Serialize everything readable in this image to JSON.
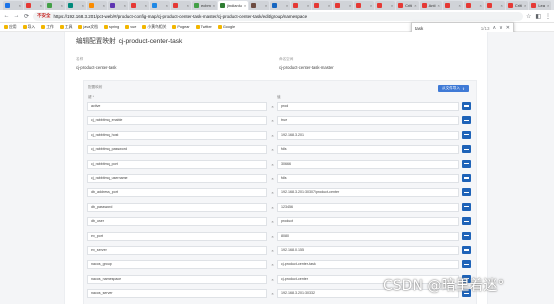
{
  "browser": {
    "tabs": [
      {
        "label": "",
        "color": "#1a73e8",
        "active": false
      },
      {
        "label": "",
        "color": "#e53935",
        "active": false
      },
      {
        "label": "",
        "color": "#43a047",
        "active": false
      },
      {
        "label": "",
        "color": "#00897b",
        "active": false
      },
      {
        "label": "",
        "color": "#fb8c00",
        "active": false
      },
      {
        "label": "",
        "color": "#5e35b1",
        "active": false
      },
      {
        "label": "",
        "color": "#e53935",
        "active": false
      },
      {
        "label": "",
        "color": "#1e88e5",
        "active": false
      },
      {
        "label": "",
        "color": "#e53935",
        "active": false
      },
      {
        "label": "ecbm",
        "color": "#43a047",
        "active": false
      },
      {
        "label": "jindianlu",
        "color": "#2e7d32",
        "active": true
      },
      {
        "label": "",
        "color": "#6d4c41",
        "active": false
      },
      {
        "label": "",
        "color": "#1565c0",
        "active": false
      },
      {
        "label": "",
        "color": "#e53935",
        "active": false
      },
      {
        "label": "",
        "color": "#e53935",
        "active": false
      },
      {
        "label": "",
        "color": "#e53935",
        "active": false
      },
      {
        "label": "",
        "color": "#e53935",
        "active": false
      },
      {
        "label": "",
        "color": "#e53935",
        "active": false
      },
      {
        "label": "Criti",
        "color": "#e53935",
        "active": false
      },
      {
        "label": "Anti",
        "color": "#e53935",
        "active": false
      },
      {
        "label": "",
        "color": "#e53935",
        "active": false
      },
      {
        "label": "",
        "color": "#e53935",
        "active": false
      },
      {
        "label": "",
        "color": "#e53935",
        "active": false
      },
      {
        "label": "Criti",
        "color": "#e53935",
        "active": false
      },
      {
        "label": "Lea",
        "color": "#e53935",
        "active": false
      }
    ],
    "url_prefix": "不安全",
    "url": "https://192.168.3.201/pct-web/#/product-config-map/cj-product-center-task-master/cj-product-center-task/edit/group/namespace",
    "bookmarks": [
      "应用",
      "导入",
      "工作",
      "工具",
      "java文档",
      "spring",
      "vue",
      "小黄鸟相关",
      "Pogear",
      "Twitter",
      "Google"
    ],
    "find": {
      "query": "task",
      "count": "1/13"
    }
  },
  "page": {
    "title_prefix": "编辑配置映射",
    "title": "cj-product-center-task",
    "meta": {
      "left_label": "名称",
      "left_value": "cj-product-center-task",
      "right_label": "命名空间",
      "right_value": "cj-product-center-task-master"
    },
    "panel_label": "配置映射",
    "export_label": "从文件导入",
    "col_key": "键 *",
    "col_value": "值",
    "rows": [
      {
        "key": "active",
        "value": "prod"
      },
      {
        "key": "cj_rabbitmq_enable",
        "value": "true"
      },
      {
        "key": "cj_rabbitmq_host",
        "value": "192.168.3.201"
      },
      {
        "key": "cj_rabbitmq_password",
        "value": "fdls"
      },
      {
        "key": "cj_rabbitmq_port",
        "value": "30666"
      },
      {
        "key": "cj_rabbitmq_username",
        "value": "fdls"
      },
      {
        "key": "db_address_port",
        "value": "192.168.3.201:30307/product-center"
      },
      {
        "key": "db_password",
        "value": "123456"
      },
      {
        "key": "db_user",
        "value": "product"
      },
      {
        "key": "ex_port",
        "value": "8080"
      },
      {
        "key": "ex_server",
        "value": "192.168.0.155"
      },
      {
        "key": "nacos_group",
        "value": "cj-product-center-task"
      },
      {
        "key": "nacos_namespace",
        "value": "cj-product-center"
      },
      {
        "key": "nacos_server",
        "value": "192.168.3.201:30332"
      }
    ]
  },
  "watermark": "CSDN @暗里着迷°"
}
